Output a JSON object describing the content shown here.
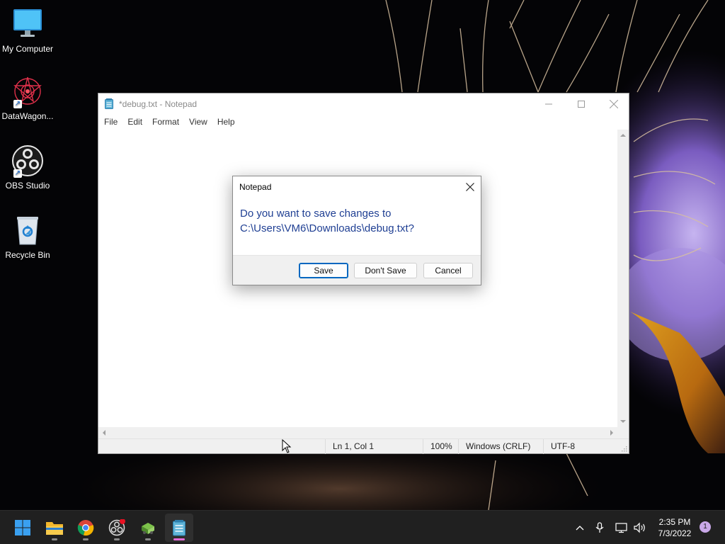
{
  "desktop": {
    "icons": [
      {
        "label": "My Computer"
      },
      {
        "label": "DataWagon..."
      },
      {
        "label": "OBS Studio"
      },
      {
        "label": "Recycle Bin"
      }
    ]
  },
  "notepad": {
    "title": "*debug.txt - Notepad",
    "menu": [
      "File",
      "Edit",
      "Format",
      "View",
      "Help"
    ],
    "status": {
      "position": "Ln 1, Col 1",
      "zoom": "100%",
      "line_ending": "Windows (CRLF)",
      "encoding": "UTF-8"
    }
  },
  "dialog": {
    "title": "Notepad",
    "message_line1": "Do you want to save changes to",
    "message_line2": "C:\\Users\\VM6\\Downloads\\debug.txt?",
    "buttons": {
      "save": "Save",
      "dont_save": "Don't Save",
      "cancel": "Cancel"
    }
  },
  "taskbar": {
    "apps": [
      "start-icon",
      "file-explorer-icon",
      "chrome-icon",
      "obs-studio-icon",
      "datawagon-icon",
      "notepad-icon"
    ],
    "clock": {
      "time": "2:35 PM",
      "date": "7/3/2022"
    },
    "notification_count": "1"
  },
  "colors": {
    "accent": "#0067c0",
    "dialog_message": "#1f3f93",
    "taskbar": "#202020"
  }
}
